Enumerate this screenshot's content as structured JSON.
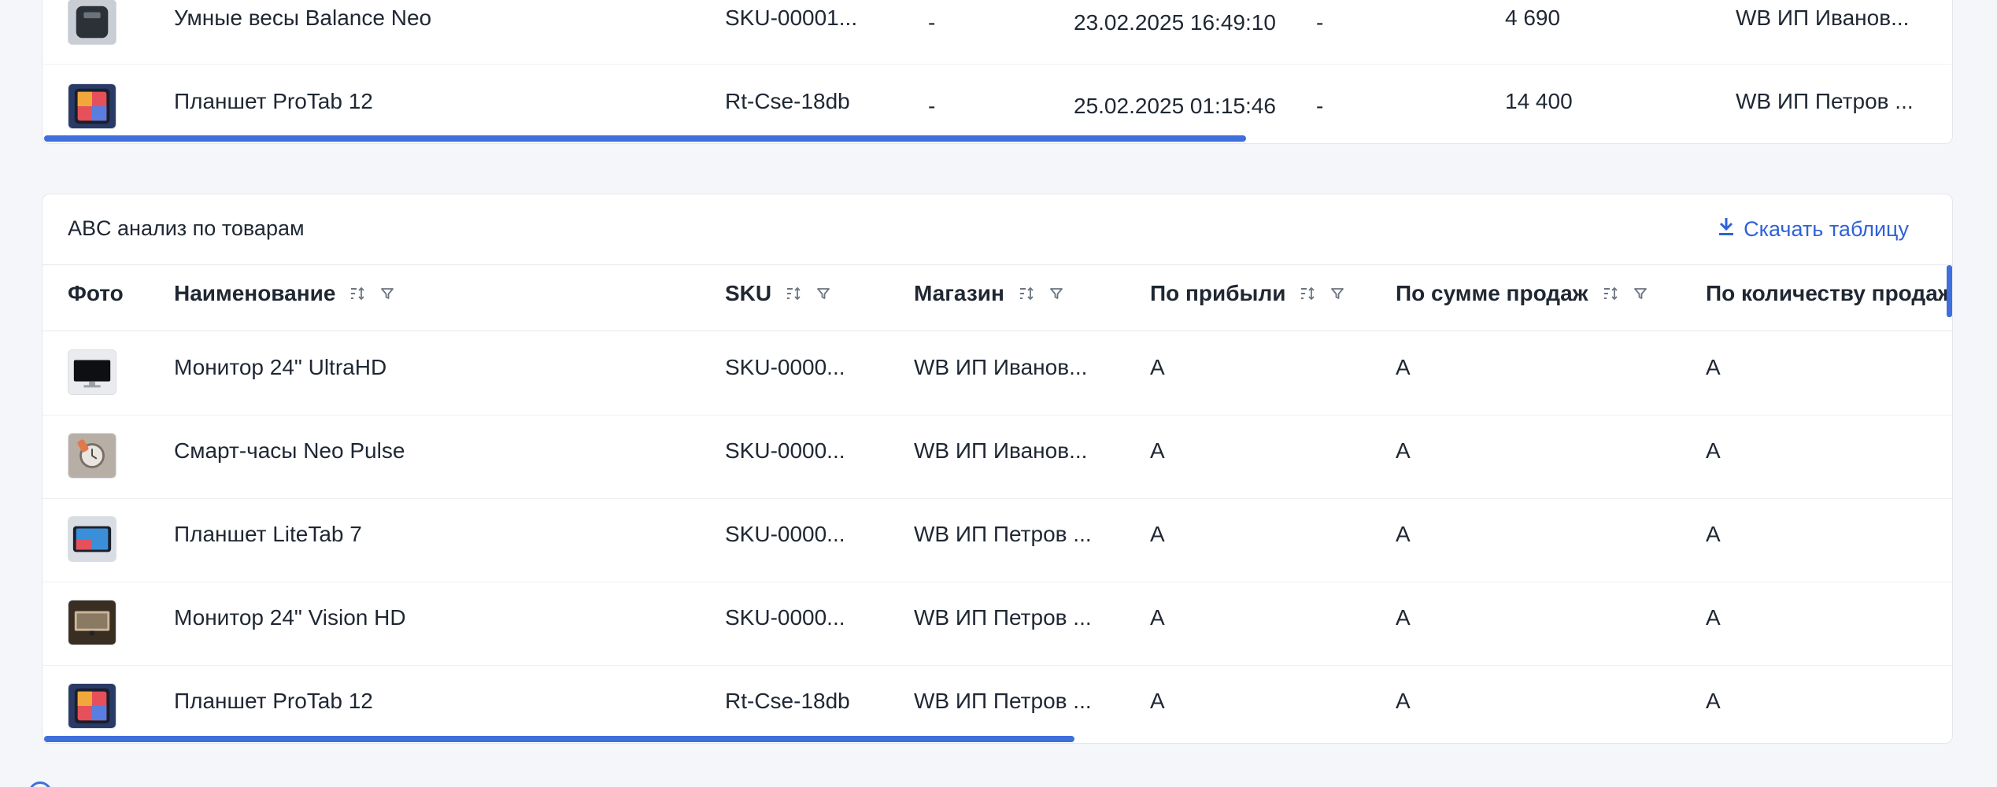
{
  "top_table": {
    "rows": [
      {
        "photo_icon": "scale-icon",
        "name": "Умные весы Balance Neo",
        "sku": "SKU-00001...",
        "col3": "-",
        "date": "23.02.2025 16:49:10",
        "col5": "-",
        "amount": "4 690",
        "store": "WB ИП Иванов..."
      },
      {
        "photo_icon": "tablet-icon",
        "name": "Планшет ProTab 12",
        "sku": "Rt-Cse-18db",
        "col3": "-",
        "date": "25.02.2025 01:15:46",
        "col5": "-",
        "amount": "14 400",
        "store": "WB ИП Петров ..."
      }
    ],
    "scroll_fraction": 0.63
  },
  "abc_table": {
    "title": "ABC анализ по товарам",
    "download_label": "Скачать таблицу",
    "download_icon": "download-icon",
    "columns": {
      "photo": "Фото",
      "name": "Наименование",
      "sku": "SKU",
      "store": "Магазин",
      "profit": "По прибыли",
      "sales_sum": "По сумме продаж",
      "sales_qty": "По количеству продаж"
    },
    "rows": [
      {
        "photo_icon": "monitor-icon",
        "name": "Монитор 24\" UltraHD",
        "sku": "SKU-0000...",
        "store": "WB ИП Иванов...",
        "profit": "A",
        "sales_sum": "A",
        "sales_qty": "A"
      },
      {
        "photo_icon": "smartwatch-icon",
        "name": "Смарт-часы Neo Pulse",
        "sku": "SKU-0000...",
        "store": "WB ИП Иванов...",
        "profit": "A",
        "sales_sum": "A",
        "sales_qty": "A"
      },
      {
        "photo_icon": "tablet-icon",
        "name": "Планшет LiteTab 7",
        "sku": "SKU-0000...",
        "store": "WB ИП Петров ...",
        "profit": "A",
        "sales_sum": "A",
        "sales_qty": "A"
      },
      {
        "photo_icon": "monitor-icon",
        "name": "Монитор 24\" Vision HD",
        "sku": "SKU-0000...",
        "store": "WB ИП Петров ...",
        "profit": "A",
        "sales_sum": "A",
        "sales_qty": "A"
      },
      {
        "photo_icon": "tablet-icon",
        "name": "Планшет ProTab 12",
        "sku": "Rt-Cse-18db",
        "store": "WB ИП Петров ...",
        "profit": "A",
        "sales_sum": "A",
        "sales_qty": "A"
      }
    ],
    "scroll_fraction": 0.54
  },
  "colors": {
    "accent": "#3f6fdc",
    "link": "#2f62d6",
    "text": "#1f2733",
    "background": "#f4f6f9"
  }
}
